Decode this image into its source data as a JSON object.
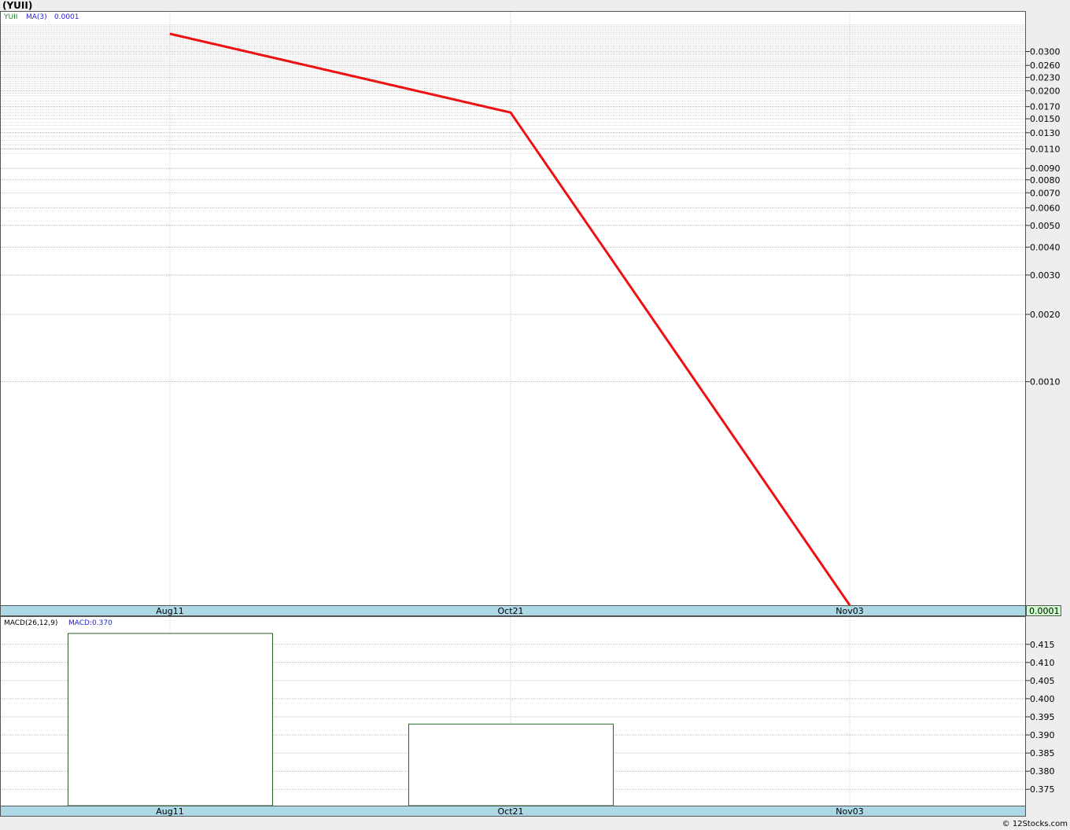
{
  "title": "(YUII)",
  "copyright": "© 12Stocks.com",
  "colors": {
    "price_line": "#ee1111",
    "axis_band": "#add8e6",
    "price_badge_bg": "#ccffcc",
    "macd_bar_stroke": "#226622",
    "symbol_color": "#228822",
    "ma_color": "#2222cc",
    "grid": "#c0c0c0"
  },
  "price_panel": {
    "legend": {
      "symbol": "YUII",
      "ma_label": "MA(3)",
      "ma_value": "0.0001"
    },
    "last_price_badge": "0.0001"
  },
  "macd_panel": {
    "legend": {
      "label": "MACD(26,12,9)",
      "value": "MACD:0.370"
    }
  },
  "chart_data": [
    {
      "type": "line",
      "scale": "log",
      "series": [
        {
          "name": "YUII",
          "x": [
            "Aug11",
            "Oct21",
            "Nov03"
          ],
          "values": [
            0.036,
            0.016,
            0.0001
          ]
        }
      ],
      "x_ticks": [
        "Aug11",
        "Oct21",
        "Nov03"
      ],
      "y_ticks": [
        "0.0300",
        "0.0260",
        "0.0230",
        "0.0200",
        "0.0170",
        "0.0150",
        "0.0130",
        "0.0110",
        "0.0090",
        "0.0080",
        "0.0070",
        "0.0060",
        "0.0050",
        "0.0040",
        "0.0030",
        "0.0020",
        "0.0010"
      ],
      "ylim": [
        0.0001,
        0.04
      ],
      "grid": true
    },
    {
      "type": "bar",
      "series": [
        {
          "name": "MACD(26,12,9)",
          "x": [
            "Aug11",
            "Oct21"
          ],
          "values": [
            0.418,
            0.393
          ]
        }
      ],
      "x_ticks": [
        "Aug11",
        "Oct21",
        "Nov03"
      ],
      "y_ticks": [
        "0.415",
        "0.410",
        "0.405",
        "0.400",
        "0.395",
        "0.390",
        "0.385",
        "0.380",
        "0.375"
      ],
      "ylim": [
        0.3705,
        0.4195
      ],
      "grid": true
    }
  ]
}
